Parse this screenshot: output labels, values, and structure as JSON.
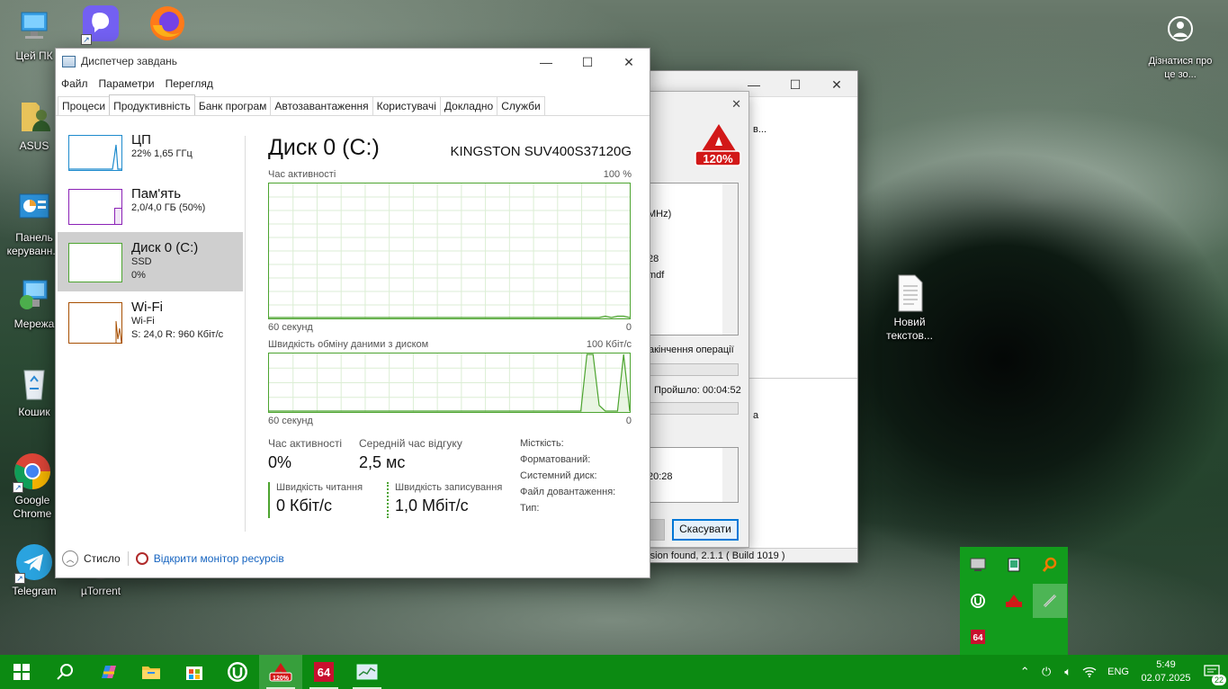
{
  "desktop": {
    "icons": [
      {
        "label": "Цей ПК"
      },
      {
        "label": "ASUS"
      },
      {
        "label": "Панель керуванн..."
      },
      {
        "label": "Мережа"
      },
      {
        "label": "Кошик"
      },
      {
        "label": "Google Chrome"
      },
      {
        "label": "Telegram"
      },
      {
        "label": "µTorrent"
      },
      {
        "label": "Новий текстов..."
      },
      {
        "label": "Дізнатися про це зо..."
      }
    ]
  },
  "task_manager": {
    "title": "Диспетчер завдань",
    "menu": [
      "Файл",
      "Параметри",
      "Перегляд"
    ],
    "tabs": [
      "Процеси",
      "Продуктивність",
      "Банк програм",
      "Автозавантаження",
      "Користувачі",
      "Докладно",
      "Служби"
    ],
    "active_tab": "Продуктивність",
    "sidebar": [
      {
        "name": "ЦП",
        "sub1": "22%  1,65 ГГц",
        "sub2": "",
        "color": "#1e8bcd"
      },
      {
        "name": "Пам'ять",
        "sub1": "2,0/4,0 ГБ (50%)",
        "sub2": "",
        "color": "#8b22b6"
      },
      {
        "name": "Диск 0 (C:)",
        "sub1": "SSD",
        "sub2": "0%",
        "color": "#4da430"
      },
      {
        "name": "Wi-Fi",
        "sub1": "Wi-Fi",
        "sub2": "S: 24,0  R: 960 Кбіт/с",
        "color": "#a74f01"
      }
    ],
    "disk": {
      "title": "Диск 0 (C:)",
      "model": "KINGSTON SUV400S37120G",
      "graph1": {
        "label": "Час активності",
        "max": "100 %",
        "left": "60 секунд",
        "right": "0"
      },
      "graph2": {
        "label": "Швидкість обміну даними з диском",
        "max": "100 Кбіт/с",
        "left": "60 секунд",
        "right": "0"
      },
      "stats": {
        "active_label": "Час активності",
        "active_value": "0%",
        "response_label": "Середній час відгуку",
        "response_value": "2,5 мс",
        "read_label": "Швидкість читання",
        "read_value": "0 Кбіт/с",
        "write_label": "Швидкість записування",
        "write_value": "1,0 Мбіт/с"
      },
      "props": [
        "Місткість:",
        "Форматований:",
        "Системний диск:",
        "Файл довантаження:",
        "Тип:"
      ]
    },
    "footer": {
      "less": "Стисло",
      "monitor": "Відкрити монітор ресурсів"
    }
  },
  "alcohol": {
    "logo": "120%",
    "fragments": {
      "f1": "в...",
      "f2": "MHz)",
      "f3": "28",
      "f4": "mdf",
      "f5": "акінчення операції",
      "f6": "Пройшло:",
      "f7": "00:04:52",
      "f8": "а",
      "f9": "20:28",
      "status": "rsion found, 2.1.1 ( Build 1019 )"
    },
    "cancel": "Скасувати"
  },
  "tray_popup": [
    "screen-icon",
    "tablet-icon",
    "search-tool-icon",
    "utorrent-icon",
    "alcohol-icon",
    "pen-icon",
    "aida64-icon"
  ],
  "taskbar": {
    "apps": [
      "start",
      "search",
      "copilot",
      "explorer",
      "store",
      "utorrent",
      "alcohol",
      "aida64",
      "taskmgr"
    ],
    "lang": "ENG",
    "time": "5:49",
    "date": "02.07.2025",
    "notifications": "22"
  },
  "colors": {
    "accent_taskbar": "#0c8a12",
    "disk_green": "#4da430",
    "cpu_blue": "#1e8bcd",
    "mem_purple": "#8b22b6",
    "wifi_orange": "#a74f01"
  },
  "disk_activity_series": [
    0,
    0,
    0,
    0,
    0,
    0,
    0,
    0,
    0,
    0,
    0,
    0,
    0,
    0,
    0,
    0,
    0,
    0,
    0,
    0,
    0,
    0,
    0,
    0,
    0,
    0,
    0,
    0,
    0,
    0,
    0,
    0,
    0,
    0,
    0,
    0,
    0,
    0,
    0,
    0,
    0,
    0,
    0,
    0,
    0,
    0,
    0,
    0,
    0,
    0,
    0,
    0,
    0,
    0,
    0,
    1,
    0,
    1,
    1,
    0
  ],
  "disk_transfer_series": [
    0,
    0,
    0,
    0,
    0,
    0,
    0,
    0,
    0,
    0,
    0,
    0,
    0,
    0,
    0,
    0,
    0,
    0,
    0,
    0,
    0,
    0,
    0,
    0,
    0,
    0,
    0,
    0,
    0,
    0,
    0,
    0,
    0,
    0,
    0,
    0,
    0,
    0,
    0,
    0,
    0,
    0,
    0,
    0,
    0,
    0,
    0,
    0,
    0,
    0,
    0,
    0,
    100,
    100,
    10,
    0,
    0,
    0,
    100,
    0
  ]
}
